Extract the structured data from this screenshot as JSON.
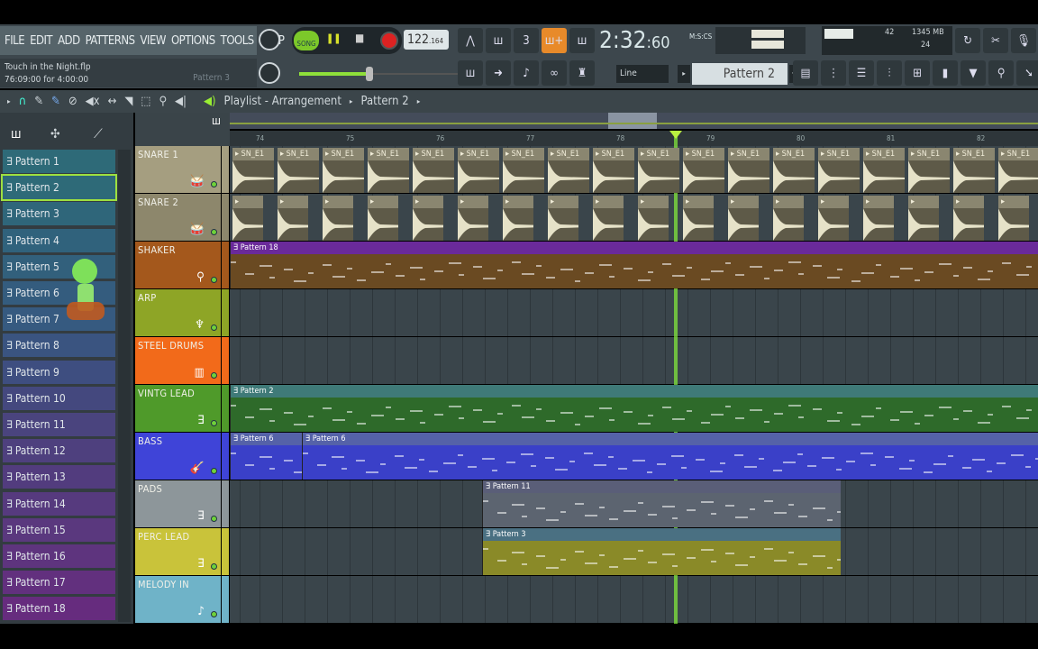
{
  "menu": [
    "FILE",
    "EDIT",
    "ADD",
    "PATTERNS",
    "VIEW",
    "OPTIONS",
    "TOOLS",
    "HELP"
  ],
  "project": {
    "file": "Touch in the Night.flp",
    "position": "76:09:00 for 4:00:00",
    "pattern_hint": "Pattern 3"
  },
  "transport": {
    "song_label": "SONG",
    "tempo": "122",
    "tempo_frac": ".164",
    "time": "2:32",
    "time_cs": ":60",
    "time_unit": "M:S:CS"
  },
  "monitor": {
    "cpu": "42",
    "memory": "1345 MB",
    "polyphony": "24"
  },
  "snap": "Line",
  "pattern_selector": "Pattern 2",
  "breadcrumb": {
    "title": "Playlist - Arrangement",
    "sub": "Pattern 2"
  },
  "patterns": [
    "Pattern 1",
    "Pattern 2",
    "Pattern 3",
    "Pattern 4",
    "Pattern 5",
    "Pattern 6",
    "Pattern 7",
    "Pattern 8",
    "Pattern 9",
    "Pattern 10",
    "Pattern 11",
    "Pattern 12",
    "Pattern 13",
    "Pattern 14",
    "Pattern 15",
    "Pattern 16",
    "Pattern 17",
    "Pattern 18"
  ],
  "selected_pattern": "Pattern 2",
  "pattern_colors": [
    "#2e6a78",
    "#2e6a78",
    "#2f667a",
    "#30627c",
    "#32607c",
    "#345c7e",
    "#365a80",
    "#3a5480",
    "#3e4e80",
    "#44487e",
    "#4a447e",
    "#4e407e",
    "#523c7e",
    "#563a7e",
    "#5a387e",
    "#5e347e",
    "#62307e",
    "#662c7e"
  ],
  "ruler_bars": [
    74,
    75,
    76,
    77,
    78,
    79,
    80,
    81,
    82
  ],
  "playhead_bar": 78.62,
  "tracks": [
    {
      "name": "SNARE 1",
      "color": "#a59e80",
      "icon": "drum-icon"
    },
    {
      "name": "SNARE 2",
      "color": "#8d876c",
      "icon": "drum-icon"
    },
    {
      "name": "SHAKER",
      "color": "#a4581c",
      "icon": "maraca-icon"
    },
    {
      "name": "ARP",
      "color": "#8ea526",
      "icon": "harp-icon"
    },
    {
      "name": "STEEL DRUMS",
      "color": "#f26a1a",
      "icon": "steel-drum-icon"
    },
    {
      "name": "VINTG LEAD",
      "color": "#4f9a2a",
      "icon": "pattern-icon"
    },
    {
      "name": "BASS",
      "color": "#3f44d8",
      "icon": "guitar-icon"
    },
    {
      "name": "PADS",
      "color": "#8d969a",
      "icon": "pattern-icon"
    },
    {
      "name": "PERC LEAD",
      "color": "#c9c33a",
      "icon": "pattern-icon"
    },
    {
      "name": "MELODY IN",
      "color": "#6fb3c8",
      "icon": "note-icon"
    }
  ],
  "clips": [
    {
      "track": 0,
      "label": "SN_E1",
      "type": "audio",
      "repeat_start": 73.7,
      "repeat_end": 82.7,
      "step": 0.5
    },
    {
      "track": 1,
      "label": "",
      "type": "audio",
      "repeat_start": 73.7,
      "repeat_end": 82.7,
      "step": 0.5
    },
    {
      "track": 2,
      "label": "Pattern 18",
      "start": 73.67,
      "end": 82.65,
      "header": "#6a2a9a",
      "body": "#6a4a22"
    },
    {
      "track": 5,
      "label": "Pattern 2",
      "start": 73.67,
      "end": 82.65,
      "header": "#3f7a78",
      "body": "#2e6a2a"
    },
    {
      "track": 6,
      "label": "Pattern 6",
      "start": 73.67,
      "end": 74.47,
      "header": "#5562a8",
      "body": "#3a40c8"
    },
    {
      "track": 6,
      "label": "Pattern 6",
      "start": 74.47,
      "end": 82.65,
      "header": "#5562a8",
      "body": "#3a40c8"
    },
    {
      "track": 7,
      "label": "Pattern 11",
      "start": 76.47,
      "end": 80.45,
      "header": "#5a5e78",
      "body": "#5c6470"
    },
    {
      "track": 8,
      "label": "Pattern 3",
      "start": 76.47,
      "end": 80.45,
      "header": "#4a7082",
      "body": "#8a8a28"
    }
  ]
}
